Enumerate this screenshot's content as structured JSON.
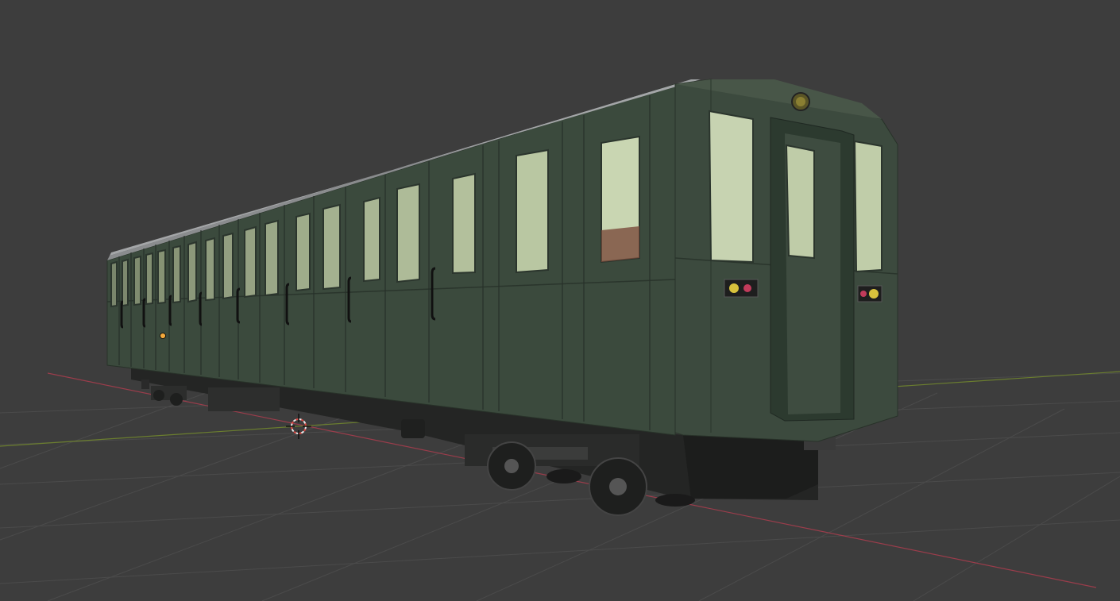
{
  "viewport": {
    "mode": "3d-viewport",
    "object": "subway-car-model",
    "colors": {
      "background": "#3d3d3d",
      "grid": "#4a4a4a",
      "x_axis": "#9a3d4b",
      "y_axis": "#6b7e2f",
      "body": "#3b4a3d",
      "body_dark": "#2e3b31",
      "roof": "#8a8c8e",
      "window_glass": "#c9d6b2",
      "chassis": "#222322",
      "cursor": "#e8e8e8",
      "cursor_red": "#d9453f",
      "origin": "#f3a93c"
    },
    "icons": [
      "3d-cursor-icon",
      "object-origin-icon"
    ]
  }
}
